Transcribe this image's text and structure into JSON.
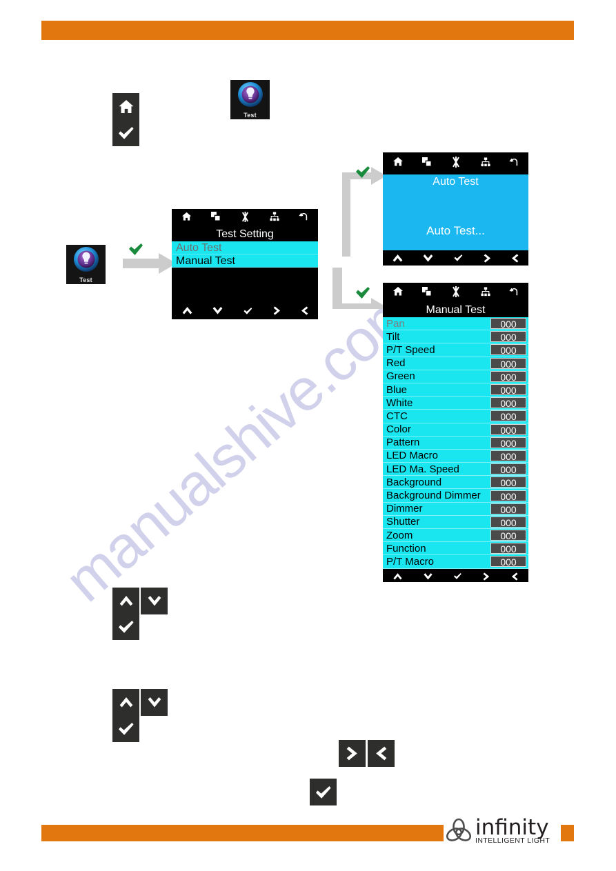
{
  "page": {
    "accent_orange": "#e2760f",
    "lcd_cyan": "#1ae6f0",
    "lcd_blue": "#1ab7f0",
    "watermark_text": "manualshive.com"
  },
  "brand": {
    "name": "infinity",
    "tagline": "INTELLIGENT LIGHT",
    "mark": "infinity-knot-logo"
  },
  "app_icons": {
    "test_top": {
      "label": "Test",
      "icon": "test-bulb-icon"
    },
    "test_flow": {
      "label": "Test",
      "icon": "test-bulb-icon"
    }
  },
  "keycaps": {
    "home": {
      "icon": "home-icon",
      "name": "home-key"
    },
    "enter": {
      "icon": "check-icon",
      "name": "enter-key"
    },
    "up": {
      "icon": "chevron-up-icon",
      "name": "up-key"
    },
    "down": {
      "icon": "chevron-down-icon",
      "name": "down-key"
    },
    "left": {
      "icon": "chevron-left-icon",
      "name": "left-key"
    },
    "right": {
      "icon": "chevron-right-icon",
      "name": "right-key"
    }
  },
  "lcd_topbar_icons": [
    "home-icon",
    "layers-icon",
    "asterisk-icon",
    "network-icon",
    "undo-icon"
  ],
  "lcd_navbar_icons": [
    "chevron-up-icon",
    "chevron-down-icon",
    "check-icon",
    "chevron-left-icon",
    "chevron-right-icon"
  ],
  "screens": {
    "test_setting": {
      "title": "Test Setting",
      "items": [
        {
          "label": "Auto Test",
          "selected": true
        },
        {
          "label": "Manual Test",
          "selected": false
        }
      ]
    },
    "auto_test": {
      "title": "Auto Test",
      "status": "Auto Test..."
    },
    "manual_test": {
      "title": "Manual Test",
      "rows": [
        {
          "label": "Pan",
          "value": "000",
          "selected": true
        },
        {
          "label": "Tilt",
          "value": "000",
          "selected": false
        },
        {
          "label": "P/T Speed",
          "value": "000",
          "selected": false
        },
        {
          "label": "Red",
          "value": "000",
          "selected": false
        },
        {
          "label": "Green",
          "value": "000",
          "selected": false
        },
        {
          "label": "Blue",
          "value": "000",
          "selected": false
        },
        {
          "label": "White",
          "value": "000",
          "selected": false
        },
        {
          "label": "CTC",
          "value": "000",
          "selected": false
        },
        {
          "label": "Color",
          "value": "000",
          "selected": false
        },
        {
          "label": "Pattern",
          "value": "000",
          "selected": false
        },
        {
          "label": "LED Macro",
          "value": "000",
          "selected": false
        },
        {
          "label": "LED Ma. Speed",
          "value": "000",
          "selected": false
        },
        {
          "label": "Background",
          "value": "000",
          "selected": false
        },
        {
          "label": "Background Dimmer",
          "value": "000",
          "selected": false
        },
        {
          "label": "Dimmer",
          "value": "000",
          "selected": false
        },
        {
          "label": "Shutter",
          "value": "000",
          "selected": false
        },
        {
          "label": "Zoom",
          "value": "000",
          "selected": false
        },
        {
          "label": "Function",
          "value": "000",
          "selected": false
        },
        {
          "label": "P/T Macro",
          "value": "000",
          "selected": false
        }
      ]
    }
  },
  "connectors": {
    "confirm_marks": [
      "green-check-mark",
      "green-check-mark",
      "green-check-mark"
    ]
  }
}
